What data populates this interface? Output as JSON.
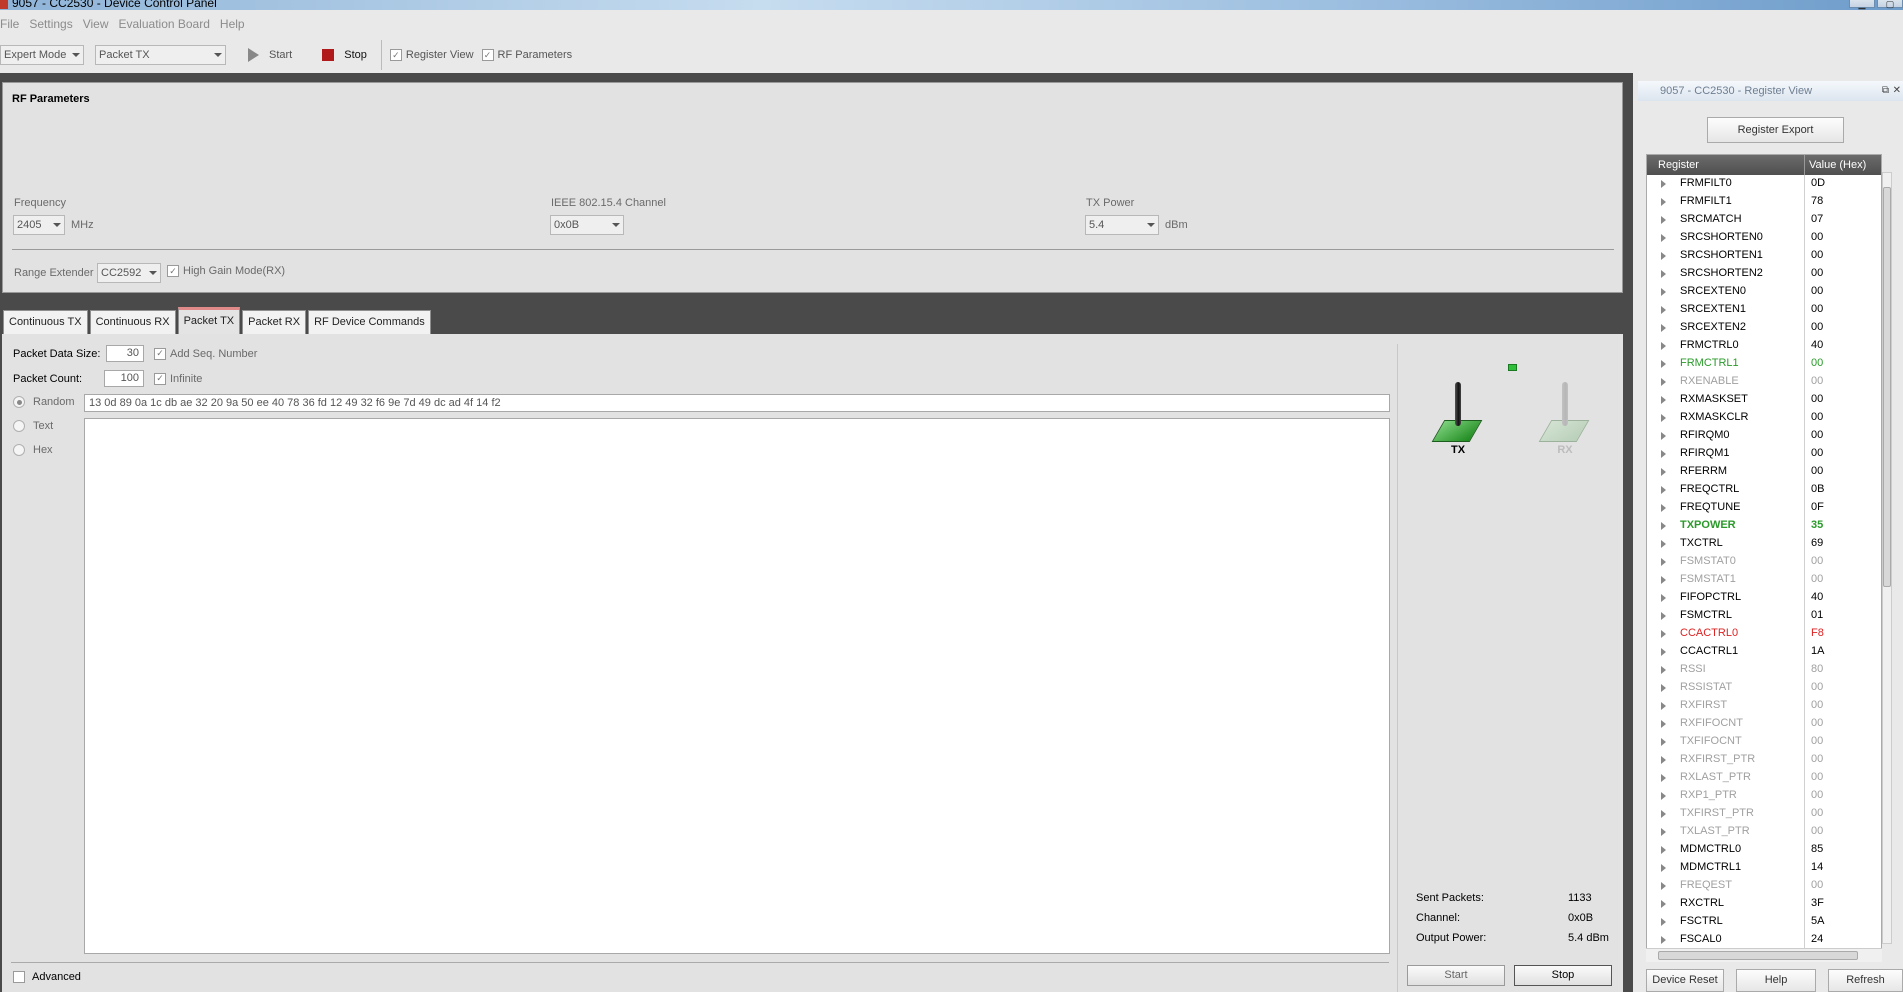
{
  "window": {
    "title": "9057 - CC2530 - Device Control Panel"
  },
  "menu": [
    "File",
    "Settings",
    "View",
    "Evaluation Board",
    "Help"
  ],
  "toolbar": {
    "mode": "Expert Mode",
    "test": "Packet TX",
    "start": "Start",
    "stop": "Stop",
    "register_view": "Register View",
    "rf_parameters": "RF Parameters"
  },
  "rf": {
    "header": "RF Parameters",
    "frequency_label": "Frequency",
    "frequency_value": "2405",
    "frequency_unit": "MHz",
    "channel_label": "IEEE 802.15.4 Channel",
    "channel_value": "0x0B",
    "txpower_label": "TX Power",
    "txpower_value": "5.4",
    "txpower_unit": "dBm",
    "range_label": "Range Extender",
    "range_value": "CC2592",
    "high_gain": "High Gain Mode(RX)"
  },
  "tabs": [
    "Continuous TX",
    "Continuous RX",
    "Packet TX",
    "Packet RX",
    "RF Device Commands"
  ],
  "packet": {
    "size_label": "Packet Data Size:",
    "size_value": "30",
    "add_seq": "Add Seq. Number",
    "count_label": "Packet Count:",
    "count_value": "100",
    "infinite": "Infinite",
    "random": "Random",
    "text": "Text",
    "hex": "Hex",
    "data": "13 0d 89 0a 1c db ae 32 20 9a 50 ee 40 78 36 fd 12 49 32 f6 9e 7d 49 dc ad 4f 14 f2",
    "advanced": "Advanced"
  },
  "status": {
    "tx": "TX",
    "rx": "RX",
    "sent_label": "Sent Packets:",
    "sent_value": "1133",
    "channel_label": "Channel:",
    "channel_value": "0x0B",
    "power_label": "Output Power:",
    "power_value": "5.4 dBm",
    "start": "Start",
    "stop": "Stop"
  },
  "regview": {
    "title": "9057 - CC2530 - Register View",
    "export": "Register Export",
    "col_register": "Register",
    "col_value": "Value (Hex)",
    "rows": [
      {
        "name": "FRMFILT0",
        "value": "0D",
        "style": "n"
      },
      {
        "name": "FRMFILT1",
        "value": "78",
        "style": "n"
      },
      {
        "name": "SRCMATCH",
        "value": "07",
        "style": "n"
      },
      {
        "name": "SRCSHORTEN0",
        "value": "00",
        "style": "n"
      },
      {
        "name": "SRCSHORTEN1",
        "value": "00",
        "style": "n"
      },
      {
        "name": "SRCSHORTEN2",
        "value": "00",
        "style": "n"
      },
      {
        "name": "SRCEXTEN0",
        "value": "00",
        "style": "n"
      },
      {
        "name": "SRCEXTEN1",
        "value": "00",
        "style": "n"
      },
      {
        "name": "SRCEXTEN2",
        "value": "00",
        "style": "n"
      },
      {
        "name": "FRMCTRL0",
        "value": "40",
        "style": "n"
      },
      {
        "name": "FRMCTRL1",
        "value": "00",
        "style": "gr"
      },
      {
        "name": "RXENABLE",
        "value": "00",
        "style": "g"
      },
      {
        "name": "RXMASKSET",
        "value": "00",
        "style": "n"
      },
      {
        "name": "RXMASKCLR",
        "value": "00",
        "style": "n"
      },
      {
        "name": "RFIRQM0",
        "value": "00",
        "style": "n"
      },
      {
        "name": "RFIRQM1",
        "value": "00",
        "style": "n"
      },
      {
        "name": "RFERRM",
        "value": "00",
        "style": "n"
      },
      {
        "name": "FREQCTRL",
        "value": "0B",
        "style": "n"
      },
      {
        "name": "FREQTUNE",
        "value": "0F",
        "style": "n"
      },
      {
        "name": "TXPOWER",
        "value": "35",
        "style": "gb"
      },
      {
        "name": "TXCTRL",
        "value": "69",
        "style": "n"
      },
      {
        "name": "FSMSTAT0",
        "value": "00",
        "style": "g"
      },
      {
        "name": "FSMSTAT1",
        "value": "00",
        "style": "g"
      },
      {
        "name": "FIFOPCTRL",
        "value": "40",
        "style": "n"
      },
      {
        "name": "FSMCTRL",
        "value": "01",
        "style": "n"
      },
      {
        "name": "CCACTRL0",
        "value": "F8",
        "style": "r"
      },
      {
        "name": "CCACTRL1",
        "value": "1A",
        "style": "n"
      },
      {
        "name": "RSSI",
        "value": "80",
        "style": "g"
      },
      {
        "name": "RSSISTAT",
        "value": "00",
        "style": "g"
      },
      {
        "name": "RXFIRST",
        "value": "00",
        "style": "g"
      },
      {
        "name": "RXFIFOCNT",
        "value": "00",
        "style": "g"
      },
      {
        "name": "TXFIFOCNT",
        "value": "00",
        "style": "g"
      },
      {
        "name": "RXFIRST_PTR",
        "value": "00",
        "style": "g"
      },
      {
        "name": "RXLAST_PTR",
        "value": "00",
        "style": "g"
      },
      {
        "name": "RXP1_PTR",
        "value": "00",
        "style": "g"
      },
      {
        "name": "TXFIRST_PTR",
        "value": "00",
        "style": "g"
      },
      {
        "name": "TXLAST_PTR",
        "value": "00",
        "style": "g"
      },
      {
        "name": "MDMCTRL0",
        "value": "85",
        "style": "n"
      },
      {
        "name": "MDMCTRL1",
        "value": "14",
        "style": "n"
      },
      {
        "name": "FREQEST",
        "value": "00",
        "style": "g"
      },
      {
        "name": "RXCTRL",
        "value": "3F",
        "style": "n"
      },
      {
        "name": "FSCTRL",
        "value": "5A",
        "style": "n"
      },
      {
        "name": "FSCAL0",
        "value": "24",
        "style": "n"
      }
    ],
    "device_reset": "Device Reset",
    "help": "Help",
    "refresh": "Refresh"
  }
}
